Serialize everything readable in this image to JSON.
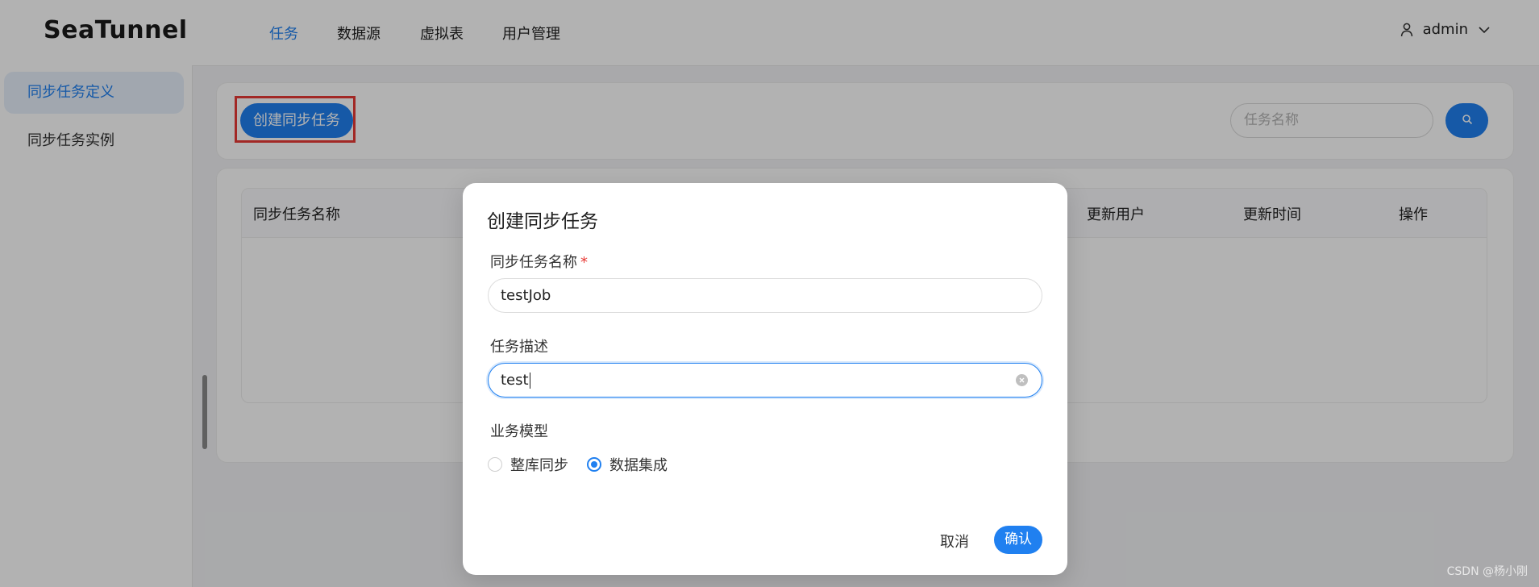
{
  "app": {
    "logo": "SeaTunnel"
  },
  "nav": {
    "items": [
      {
        "label": "任务",
        "active": true
      },
      {
        "label": "数据源",
        "active": false
      },
      {
        "label": "虚拟表",
        "active": false
      },
      {
        "label": "用户管理",
        "active": false
      }
    ]
  },
  "user": {
    "name": "admin",
    "icon": "user-icon",
    "dropdown_icon": "chevron-down-icon"
  },
  "sidebar": {
    "items": [
      {
        "label": "同步任务定义",
        "active": true
      },
      {
        "label": "同步任务实例",
        "active": false
      }
    ]
  },
  "toolbar": {
    "create_label": "创建同步任务",
    "search_placeholder": "任务名称",
    "search_icon": "search-icon"
  },
  "table": {
    "columns": [
      "同步任务名称",
      "更新用户",
      "更新时间",
      "操作"
    ]
  },
  "modal": {
    "title": "创建同步任务",
    "name_label": "同步任务名称",
    "required_mark": "*",
    "name_value": "testJob",
    "desc_label": "任务描述",
    "desc_value": "test",
    "model_label": "业务模型",
    "model_options": [
      {
        "label": "整库同步",
        "checked": false
      },
      {
        "label": "数据集成",
        "checked": true
      }
    ],
    "cancel_label": "取消",
    "ok_label": "确认"
  },
  "watermark": "CSDN @杨小刚",
  "colors": {
    "accent": "#2080f0",
    "highlight": "#e83a35"
  }
}
